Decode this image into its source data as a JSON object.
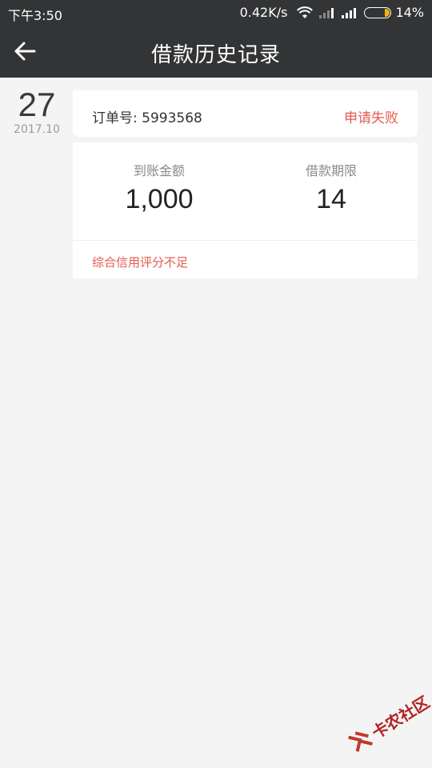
{
  "status_bar": {
    "time": "下午3:50",
    "speed": "0.42K/s",
    "battery": "14%",
    "icons": [
      "wifi-icon",
      "signal-icon",
      "signal-icon",
      "battery-icon"
    ]
  },
  "nav": {
    "back_icon": "arrow-left-icon",
    "title": "借款历史记录"
  },
  "record": {
    "day": "27",
    "year_month": "2017.10",
    "order_label": "订单号: 5993568",
    "status": "申请失败",
    "amount_label": "到账金额",
    "amount_value": "1,000",
    "term_label": "借款期限",
    "term_value": "14",
    "reason": "综合信用评分不足"
  },
  "watermark": {
    "text": "卡农社区"
  },
  "colors": {
    "header_bg": "#333436",
    "accent_red": "#e35a4f",
    "page_bg": "#f4f4f4"
  }
}
